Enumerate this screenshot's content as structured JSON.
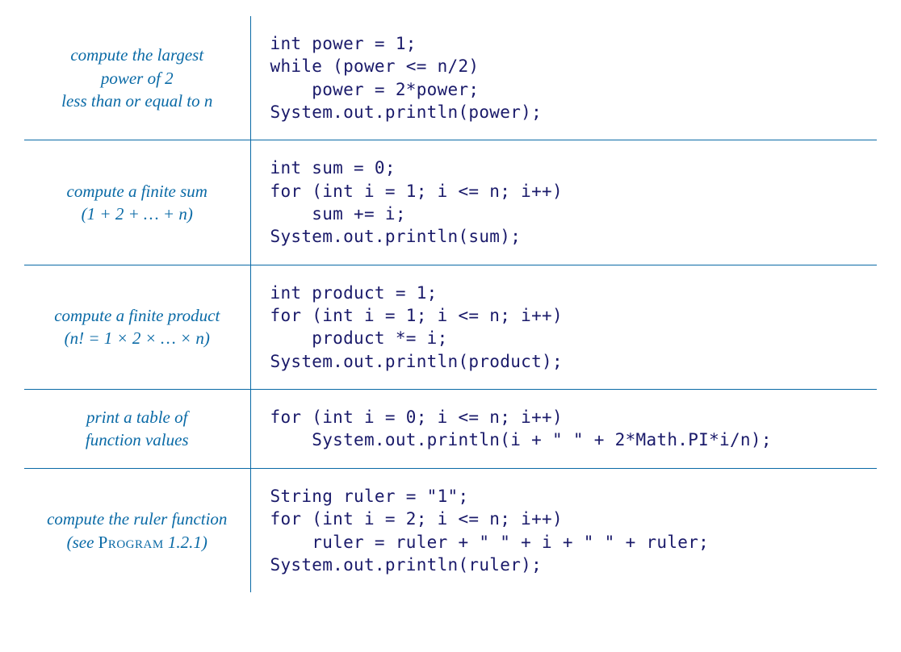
{
  "rows": [
    {
      "desc_line1": "compute the largest",
      "desc_line2": "power of 2",
      "desc_line3": "less than or equal to n",
      "code": "int power = 1;\nwhile (power <= n/2)\n    power = 2*power;\nSystem.out.println(power);"
    },
    {
      "desc_line1": "compute a finite sum",
      "desc_line2": "(1 + 2 + … + n)",
      "code": "int sum = 0;\nfor (int i = 1; i <= n; i++)\n    sum += i;\nSystem.out.println(sum);"
    },
    {
      "desc_line1": "compute a finite product",
      "desc_line2": "(n! = 1 × 2 ×  … × n)",
      "code": "int product = 1;\nfor (int i = 1; i <= n; i++)\n    product *= i;\nSystem.out.println(product);"
    },
    {
      "desc_line1": "print a table of",
      "desc_line2": "function values",
      "code": "for (int i = 0; i <= n; i++)\n    System.out.println(i + \" \" + 2*Math.PI*i/n);"
    },
    {
      "desc_line1": "compute the ruler function",
      "desc_line2_prefix": "(see ",
      "desc_line2_sc": "Program",
      "desc_line2_suffix": " 1.2.1)",
      "code": "String ruler = \"1\";\nfor (int i = 2; i <= n; i++)\n    ruler = ruler + \" \" + i + \" \" + ruler;\nSystem.out.println(ruler);"
    }
  ]
}
